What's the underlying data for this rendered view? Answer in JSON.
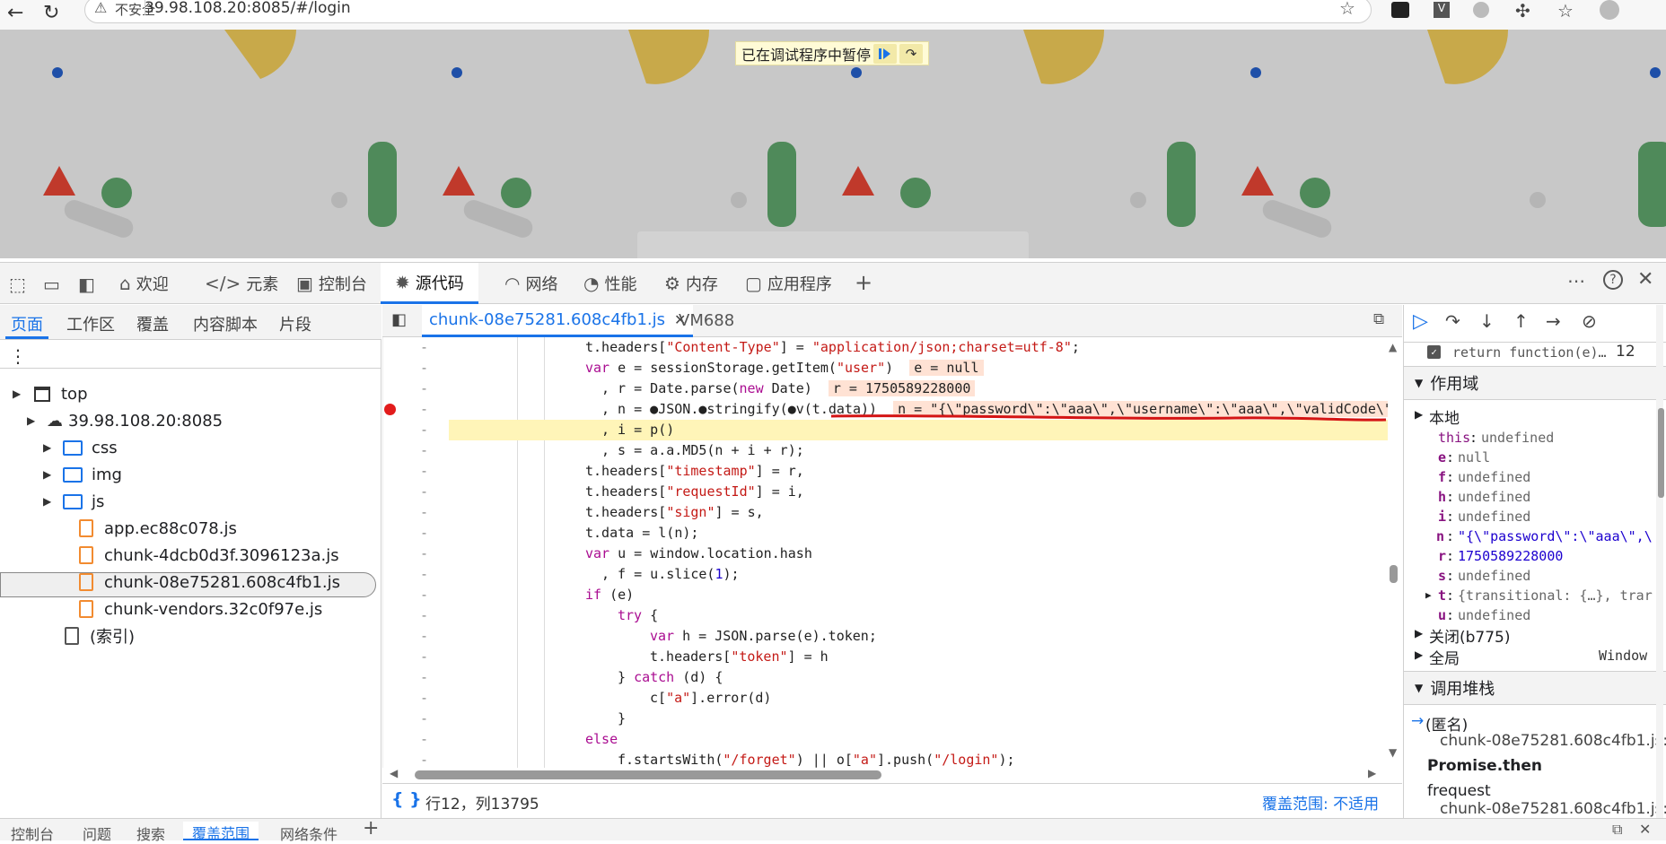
{
  "browser": {
    "security_label": "不安全",
    "url": "39.98.108.20:8085/#/login",
    "profile_letter": "V"
  },
  "page": {
    "paused_text": "已在调试程序中暂停"
  },
  "devtools": {
    "tabs": [
      {
        "label": "欢迎",
        "icon": "home-icon"
      },
      {
        "label": "元素",
        "icon": "code-icon"
      },
      {
        "label": "控制台",
        "icon": "console-icon"
      },
      {
        "label": "源代码",
        "icon": "bug-icon"
      },
      {
        "label": "网络",
        "icon": "wifi-icon"
      },
      {
        "label": "性能",
        "icon": "performance-icon"
      },
      {
        "label": "内存",
        "icon": "memory-icon"
      },
      {
        "label": "应用程序",
        "icon": "application-icon"
      }
    ],
    "active_tab": "源代码"
  },
  "navigator": {
    "subtabs": [
      "页面",
      "工作区",
      "覆盖",
      "内容脚本",
      "片段"
    ],
    "tree": {
      "top": "top",
      "host": "39.98.108.20:8085",
      "folders": [
        "css",
        "img",
        "js"
      ],
      "files": [
        "app.ec88c078.js",
        "chunk-4dcb0d3f.3096123a.js",
        "chunk-08e75281.608c4fb1.js",
        "chunk-vendors.32c0f97e.js"
      ],
      "index": "(索引)"
    },
    "selected_file": "chunk-08e75281.608c4fb1.js"
  },
  "editor": {
    "tabs": [
      "chunk-08e75281.608c4fb1.js",
      "VM688"
    ],
    "lines": [
      {
        "indent": "    ",
        "parts": [
          [
            "p",
            "t.headers["
          ],
          [
            "s",
            "\"Content-Type\""
          ],
          [
            "p",
            "] = "
          ],
          [
            "s",
            "\"application/json;charset=utf-8\""
          ],
          [
            "p",
            ";"
          ]
        ]
      },
      {
        "indent": "    ",
        "parts": [
          [
            "k",
            "var "
          ],
          [
            "p",
            "e = sessionStorage.getItem("
          ],
          [
            "s",
            "\"user\""
          ],
          [
            "p",
            ")"
          ]
        ],
        "inline": "e = null"
      },
      {
        "indent": "      ",
        "parts": [
          [
            "p",
            ", r = Date.parse("
          ],
          [
            "k",
            "new "
          ],
          [
            "p",
            "Date)"
          ]
        ],
        "inline": "r = 1750589228000"
      },
      {
        "indent": "      ",
        "parts": [
          [
            "p",
            ", n = ●JSON.●stringify(●v(t.data))"
          ]
        ],
        "inline": "n = \"{\\\"password\\\":\\\"aaa\\\",\\\"username\\\":\\\"aaa\\\",\\\"validCode\\\":"
      },
      {
        "indent": "      ",
        "parts": [
          [
            "p",
            ", i = p()"
          ]
        ]
      },
      {
        "indent": "      ",
        "parts": [
          [
            "p",
            ", s = a.a.MD5(n + i + r);"
          ]
        ]
      },
      {
        "indent": "    ",
        "parts": [
          [
            "p",
            "t.headers["
          ],
          [
            "s",
            "\"timestamp\""
          ],
          [
            "p",
            "] = r,"
          ]
        ]
      },
      {
        "indent": "    ",
        "parts": [
          [
            "p",
            "t.headers["
          ],
          [
            "s",
            "\"requestId\""
          ],
          [
            "p",
            "] = i,"
          ]
        ]
      },
      {
        "indent": "    ",
        "parts": [
          [
            "p",
            "t.headers["
          ],
          [
            "s",
            "\"sign\""
          ],
          [
            "p",
            "] = s,"
          ]
        ]
      },
      {
        "indent": "    ",
        "parts": [
          [
            "p",
            "t.data = l(n);"
          ]
        ]
      },
      {
        "indent": "    ",
        "parts": [
          [
            "k",
            "var "
          ],
          [
            "p",
            "u = window.location.hash"
          ]
        ]
      },
      {
        "indent": "      ",
        "parts": [
          [
            "p",
            ", f = u.slice("
          ],
          [
            "n",
            "1"
          ],
          [
            "p",
            ");"
          ]
        ]
      },
      {
        "indent": "    ",
        "parts": [
          [
            "k",
            "if "
          ],
          [
            "p",
            "(e)"
          ]
        ]
      },
      {
        "indent": "        ",
        "parts": [
          [
            "k",
            "try "
          ],
          [
            "p",
            "{"
          ]
        ]
      },
      {
        "indent": "            ",
        "parts": [
          [
            "k",
            "var "
          ],
          [
            "p",
            "h = JSON.parse(e).token;"
          ]
        ]
      },
      {
        "indent": "            ",
        "parts": [
          [
            "p",
            "t.headers["
          ],
          [
            "s",
            "\"token\""
          ],
          [
            "p",
            "] = h"
          ]
        ]
      },
      {
        "indent": "        ",
        "parts": [
          [
            "p",
            "} "
          ],
          [
            "k",
            "catch "
          ],
          [
            "p",
            "(d) {"
          ]
        ]
      },
      {
        "indent": "            ",
        "parts": [
          [
            "p",
            "c["
          ],
          [
            "s",
            "\"a\""
          ],
          [
            "p",
            "].error(d)"
          ]
        ]
      },
      {
        "indent": "        ",
        "parts": [
          [
            "p",
            "}"
          ]
        ]
      },
      {
        "indent": "    ",
        "parts": [
          [
            "k",
            "else"
          ]
        ]
      },
      {
        "indent": "        ",
        "parts": [
          [
            "p",
            "f.startsWith("
          ],
          [
            "s",
            "\"/forget\""
          ],
          [
            "p",
            ") || o["
          ],
          [
            "s",
            "\"a\""
          ],
          [
            "p",
            "].push("
          ],
          [
            "s",
            "\"/login\""
          ],
          [
            "p",
            ");"
          ]
        ]
      }
    ],
    "gutter_mark": "-",
    "status_position": "行12，列13795",
    "status_coverage": "覆盖范围: 不适用"
  },
  "debugger": {
    "breakpoint_item": "return function(e)…",
    "breakpoint_line": "12",
    "scope_header": "作用域",
    "local_header": "本地",
    "locals": [
      {
        "name": "this",
        "value": "undefined"
      },
      {
        "name": "e",
        "value": "null"
      },
      {
        "name": "f",
        "value": "undefined"
      },
      {
        "name": "h",
        "value": "undefined"
      },
      {
        "name": "i",
        "value": "undefined"
      },
      {
        "name": "n",
        "value": "\"{\\\"password\\\":\\\"aaa\\\",\\"
      },
      {
        "name": "r",
        "value": "1750589228000"
      },
      {
        "name": "s",
        "value": "undefined"
      },
      {
        "name": "t",
        "value": "{transitional: {…}, trar"
      },
      {
        "name": "u",
        "value": "undefined"
      }
    ],
    "closure_label": "关闭(b775)",
    "global_label": "全局",
    "global_value": "Window",
    "callstack_header": "调用堆栈",
    "frames": [
      {
        "name": "(匿名)",
        "location": "chunk-08e75281.608c4fb1.js:"
      },
      {
        "name": "Promise.then",
        "location": ""
      },
      {
        "name": "frequest",
        "location": "chunk-08e75281.608c4fb1.js:"
      }
    ]
  },
  "drawer": {
    "tabs": [
      "控制台",
      "问题",
      "搜索",
      "覆盖范围",
      "网络条件"
    ],
    "active": "覆盖范围"
  }
}
